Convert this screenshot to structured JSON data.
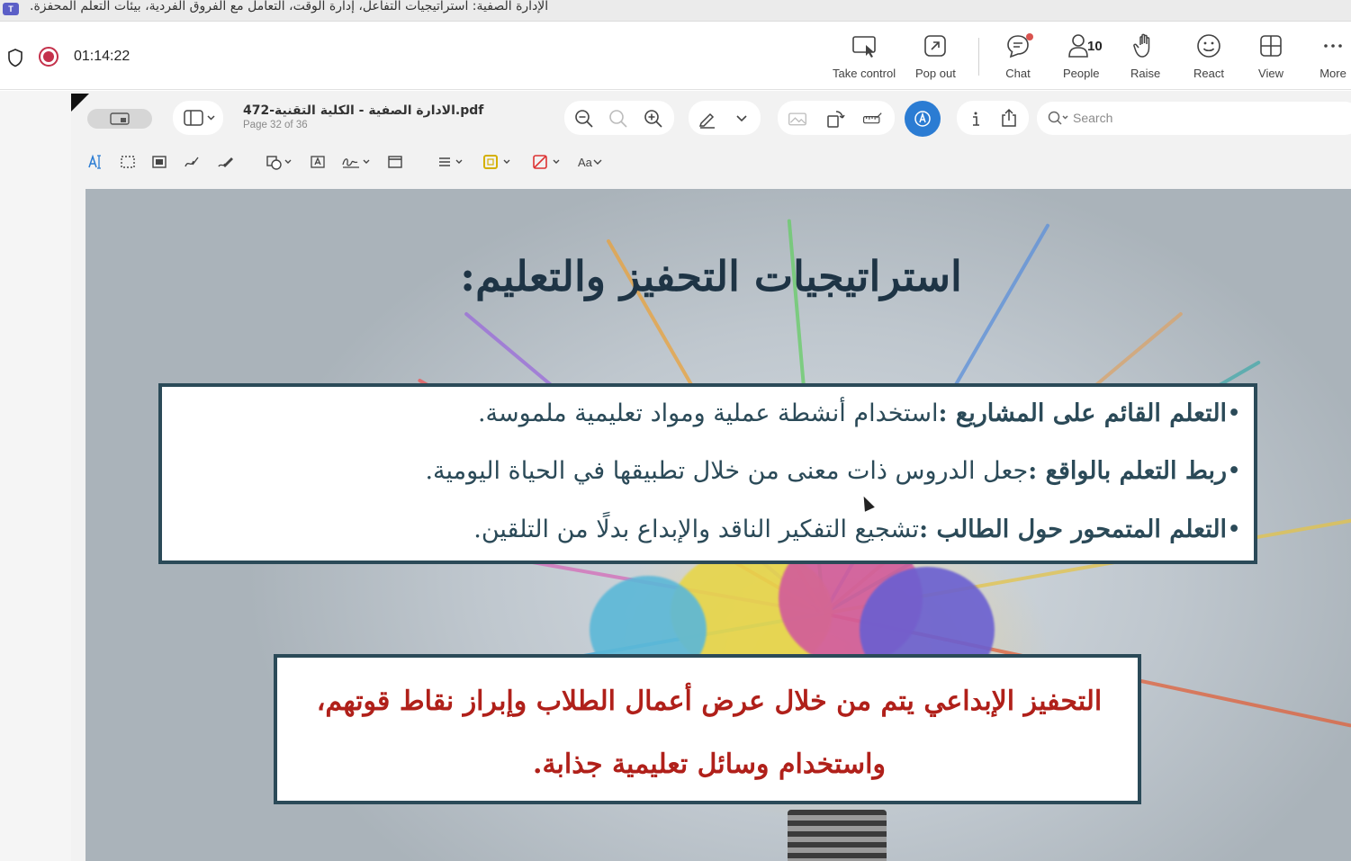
{
  "window": {
    "title": "الإدارة الصفية: استراتيجيات التفاعل، إدارة الوقت، التعامل مع الفروق الفردية، بيئات التعلم المحفزة.",
    "app_icon": "T"
  },
  "meeting": {
    "timer": "01:14:22",
    "buttons": {
      "take_control": "Take control",
      "pop_out": "Pop out",
      "chat": "Chat",
      "people": "People",
      "people_count": "10",
      "raise": "Raise",
      "react": "React",
      "view": "View",
      "more": "More"
    },
    "colors": {
      "record": "#c4314b",
      "notification": "#d9534f"
    }
  },
  "viewer": {
    "document_name": "472-الادارة الصفية - الكلية التقنية.pdf",
    "page_info": "Page 32 of 36",
    "search_placeholder": "Search",
    "markup_font_label": "Aa",
    "accent": "#2b7cd3"
  },
  "slide": {
    "title": "استراتيجيات التحفيز والتعليم:",
    "bullets": [
      {
        "bold": "التعلم القائم على المشاريع :",
        "text": "استخدام أنشطة عملية ومواد تعليمية ملموسة."
      },
      {
        "bold": "ربط التعلم بالواقع :",
        "text": "جعل الدروس ذات معنى من خلال تطبيقها في الحياة اليومية."
      },
      {
        "bold": "التعلم المتمحور حول الطالب :",
        "text": "تشجيع التفكير الناقد والإبداع بدلًا من التلقين."
      }
    ],
    "highlight_line1": "التحفيز الإبداعي يتم من خلال عرض أعمال الطلاب وإبراز نقاط قوتهم،",
    "highlight_line2": "واستخدام وسائل تعليمية جذابة.",
    "colors": {
      "heading": "#1e3445",
      "box_border": "#2b4a58",
      "highlight_text": "#b0201a"
    }
  }
}
